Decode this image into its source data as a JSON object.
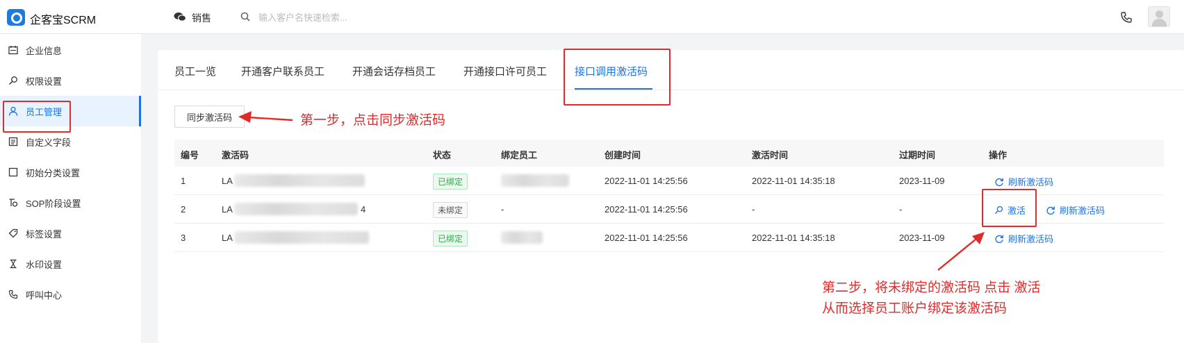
{
  "header": {
    "brand": "企客宝SCRM",
    "dept": "销售",
    "search_placeholder": "输入客户名快速检索..."
  },
  "sidebar": {
    "items": [
      {
        "label": "企业信息",
        "icon": "calendar-icon"
      },
      {
        "label": "权限设置",
        "icon": "key-icon"
      },
      {
        "label": "员工管理",
        "icon": "user-icon",
        "active": true
      },
      {
        "label": "自定义字段",
        "icon": "form-icon"
      },
      {
        "label": "初始分类设置",
        "icon": "square-icon"
      },
      {
        "label": "SOP阶段设置",
        "icon": "sop-icon"
      },
      {
        "label": "标签设置",
        "icon": "tag-icon"
      },
      {
        "label": "水印设置",
        "icon": "hourglass-icon"
      },
      {
        "label": "呼叫中心",
        "icon": "phone-icon"
      }
    ]
  },
  "tabs": [
    {
      "label": "员工一览"
    },
    {
      "label": "开通客户联系员工"
    },
    {
      "label": "开通会话存档员工"
    },
    {
      "label": "开通接口许可员工"
    },
    {
      "label": "接口调用激活码",
      "active": true
    }
  ],
  "toolbar": {
    "sync_label": "同步激活码"
  },
  "table": {
    "columns": [
      "编号",
      "激活码",
      "状态",
      "绑定员工",
      "创建时间",
      "激活时间",
      "过期时间",
      "操作"
    ],
    "rows": [
      {
        "id": "1",
        "code_prefix": "LA",
        "code_suffix": "",
        "status": "已绑定",
        "status_type": "bound",
        "employee": "",
        "created": "2022-11-01 14:25:56",
        "activated": "2022-11-01 14:35:18",
        "expires": "2023-11-09",
        "actions": [
          "刷新激活码"
        ]
      },
      {
        "id": "2",
        "code_prefix": "LA",
        "code_suffix": "4",
        "status": "未绑定",
        "status_type": "unbound",
        "employee": "-",
        "created": "2022-11-01 14:25:56",
        "activated": "-",
        "expires": "-",
        "actions": [
          "激活",
          "刷新激活码"
        ]
      },
      {
        "id": "3",
        "code_prefix": "LA",
        "code_suffix": "",
        "status": "已绑定",
        "status_type": "bound",
        "employee": "",
        "created": "2022-11-01 14:25:56",
        "activated": "2022-11-01 14:35:18",
        "expires": "2023-11-09",
        "actions": [
          "刷新激活码"
        ]
      }
    ]
  },
  "annotations": {
    "step1": "第一步，点击同步激活码",
    "step2_line1": "第二步，将未绑定的激活码 点击 激活",
    "step2_line2": "从而选择员工账户绑定该激活码",
    "color": "#e02b2b"
  },
  "colors": {
    "accent": "#1a73e8",
    "bound": "#2fa84f"
  }
}
